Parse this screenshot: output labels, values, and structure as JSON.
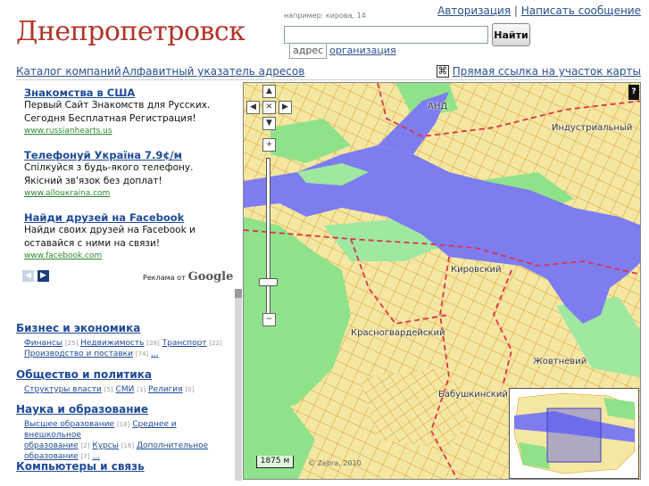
{
  "header": {
    "logo": "Днепропетровск",
    "search_example": "например: кирова, 14",
    "search_value": "",
    "search_button": "Найти",
    "tab_address": "адрес",
    "tab_org": "организация",
    "link_login": "Авторизация",
    "separator": "|",
    "link_message": "Написать сообщение"
  },
  "nav": {
    "catalog": "Каталог компаний",
    "index": "Алфавитный указатель адресов",
    "permalink": "Прямая ссылка на участок карты",
    "permalink_icon": "expand-icon"
  },
  "ads": [
    {
      "title": "Знакомства в США",
      "lines": [
        "Первый Сайт Знакомств для Русских.",
        "Сегодня Бесплатная Регистрация!"
      ],
      "url": "www.russianhearts.us"
    },
    {
      "title": "Телефонуй Україна 7.9¢/м",
      "lines": [
        "Спілкуйся з будь-якого телефону.",
        "Якісний зв'язок без доплат!"
      ],
      "url": "www.allouкraina.com"
    },
    {
      "title": "Найди друзей на Facebook",
      "lines": [
        "Найди своих друзей на Facebook и",
        "оставайся с ними на связи!"
      ],
      "url": "www.facebook.com"
    }
  ],
  "ads_footer": {
    "prefix": "Реклама от",
    "brand": "Google"
  },
  "categories": [
    {
      "title": "Бизнес и экономика",
      "rows": [
        [
          {
            "name": "Финансы",
            "count": "[25]"
          },
          {
            "name": "Недвижимость",
            "count": "[28]"
          },
          {
            "name": "Транспорт",
            "count": "[22]"
          }
        ],
        [
          {
            "name": "Производство и поставки",
            "count": "[74]"
          },
          {
            "name": "...",
            "count": ""
          }
        ]
      ]
    },
    {
      "title": "Общество и политика",
      "rows": [
        [
          {
            "name": "Структуры власти",
            "count": "[5]"
          },
          {
            "name": "СМИ",
            "count": "[1]"
          },
          {
            "name": "Религия",
            "count": "[0]"
          }
        ]
      ]
    },
    {
      "title": "Наука и образование",
      "rows": [
        [
          {
            "name": "Высшее образование",
            "count": "[18]"
          },
          {
            "name": "Среднее и внешкольное",
            "count": ""
          }
        ],
        [
          {
            "name": "образование",
            "count": "[2]"
          },
          {
            "name": "Курсы",
            "count": "[16]"
          },
          {
            "name": "Дополнительное",
            "count": ""
          }
        ],
        [
          {
            "name": "образование",
            "count": "[7]"
          },
          {
            "name": "...",
            "count": ""
          }
        ]
      ]
    },
    {
      "title": "Компьютеры и связь",
      "rows": []
    }
  ],
  "map": {
    "labels": {
      "and": "АНД",
      "industrial": "Индустриальный",
      "kirovsky": "Кировский",
      "krasnogvardeisky": "Красногвардейский",
      "zhovtnevy": "Жовтневий",
      "babushkinsky": "Бабушкинский"
    },
    "help": "?",
    "scale": "1875 м",
    "copyright": "© Zebra, 2010",
    "zoom_in": "+",
    "zoom_out": "−",
    "zoom_level_fraction": 0.2,
    "colors": {
      "city": "#f4e7a2",
      "water": "#7d7df0",
      "green": "#8fe28a",
      "road": "#d89a33",
      "border": "#e0304b"
    }
  }
}
